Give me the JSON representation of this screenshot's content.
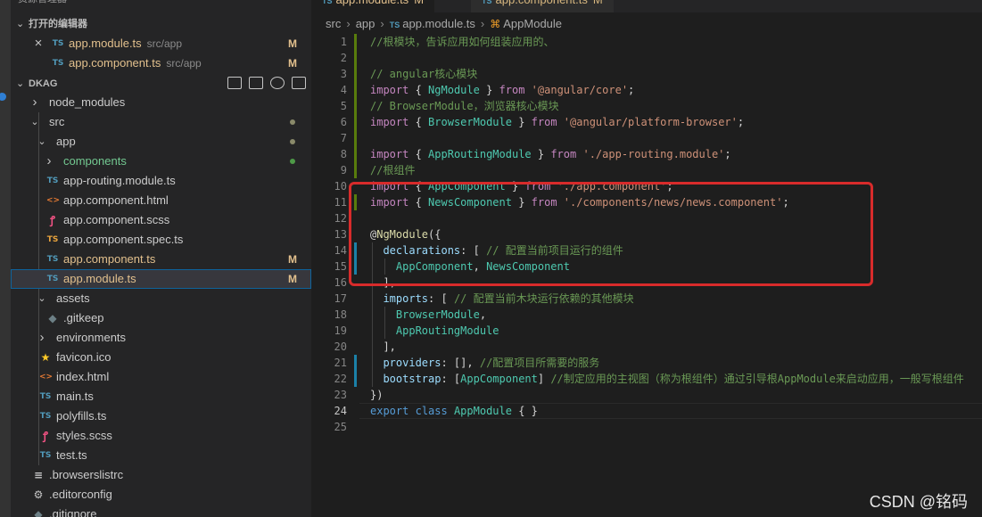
{
  "sidebar": {
    "open_editors_title": "打开的编辑器",
    "top_clipped_title": "资源管理器",
    "open_editors": [
      {
        "name": "app.module.ts",
        "path": "src/app",
        "status": "M"
      },
      {
        "name": "app.component.ts",
        "path": "src/app",
        "status": "M"
      }
    ],
    "close_icon": "×",
    "project_title": "DKAG",
    "tree": [
      {
        "name": "node_modules",
        "kind": "folder",
        "collapsed": true
      },
      {
        "name": "src",
        "kind": "folder",
        "collapsed": false
      },
      {
        "name": "app",
        "kind": "folder",
        "collapsed": false
      },
      {
        "name": "components",
        "kind": "folder",
        "collapsed": true
      },
      {
        "name": "app-routing.module.ts",
        "kind": "ts"
      },
      {
        "name": "app.component.html",
        "kind": "html"
      },
      {
        "name": "app.component.scss",
        "kind": "scss"
      },
      {
        "name": "app.component.spec.ts",
        "kind": "spec"
      },
      {
        "name": "app.component.ts",
        "kind": "ts",
        "status": "M"
      },
      {
        "name": "app.module.ts",
        "kind": "ts",
        "status": "M"
      },
      {
        "name": "assets",
        "kind": "folder",
        "collapsed": false
      },
      {
        "name": ".gitkeep",
        "kind": "git"
      },
      {
        "name": "environments",
        "kind": "folder",
        "collapsed": true
      },
      {
        "name": "favicon.ico",
        "kind": "star"
      },
      {
        "name": "index.html",
        "kind": "html"
      },
      {
        "name": "main.ts",
        "kind": "ts"
      },
      {
        "name": "polyfills.ts",
        "kind": "ts"
      },
      {
        "name": "styles.scss",
        "kind": "scss"
      },
      {
        "name": "test.ts",
        "kind": "ts"
      },
      {
        "name": ".browserslistrc",
        "kind": "lines"
      },
      {
        "name": ".editorconfig",
        "kind": "gear"
      },
      {
        "name": ".gitignore",
        "kind": "git"
      }
    ],
    "icon_glyphs": {
      "ts": "TS",
      "html": "<>",
      "scss": "ꝭ",
      "spec": "TS",
      "git": "◆",
      "star": "★",
      "lines": "≡",
      "gear": "⚙"
    }
  },
  "editor": {
    "tabs": [
      {
        "name": "app.module.ts",
        "status": "M"
      },
      {
        "name": "app.component.ts",
        "status": "M"
      }
    ],
    "breadcrumb": [
      "src",
      "app",
      "app.module.ts",
      "AppModule"
    ],
    "current_line": 24,
    "lines": [
      [
        [
          "c-com",
          "//根模块，告诉应用如何组装应用的、"
        ]
      ],
      [],
      [
        [
          "c-com",
          "// angular核心模块"
        ]
      ],
      [
        [
          "c-kw",
          "import"
        ],
        [
          "c-pun",
          " { "
        ],
        [
          "c-cls",
          "NgModule"
        ],
        [
          "c-pun",
          " } "
        ],
        [
          "c-kw",
          "from"
        ],
        [
          "c-pun",
          " "
        ],
        [
          "c-str",
          "'@angular/core'"
        ],
        [
          "c-pun",
          ";"
        ]
      ],
      [
        [
          "c-com",
          "// BrowserModule，浏览器核心模块"
        ]
      ],
      [
        [
          "c-kw",
          "import"
        ],
        [
          "c-pun",
          " { "
        ],
        [
          "c-cls",
          "BrowserModule"
        ],
        [
          "c-pun",
          " } "
        ],
        [
          "c-kw",
          "from"
        ],
        [
          "c-pun",
          " "
        ],
        [
          "c-str",
          "'@angular/platform-browser'"
        ],
        [
          "c-pun",
          ";"
        ]
      ],
      [],
      [
        [
          "c-kw",
          "import"
        ],
        [
          "c-pun",
          " { "
        ],
        [
          "c-cls",
          "AppRoutingModule"
        ],
        [
          "c-pun",
          " } "
        ],
        [
          "c-kw",
          "from"
        ],
        [
          "c-pun",
          " "
        ],
        [
          "c-str",
          "'./app-routing.module'"
        ],
        [
          "c-pun",
          ";"
        ]
      ],
      [
        [
          "c-com",
          "//根组件"
        ]
      ],
      [
        [
          "c-kw",
          "import"
        ],
        [
          "c-pun",
          " { "
        ],
        [
          "c-cls",
          "AppComponent"
        ],
        [
          "c-pun",
          " } "
        ],
        [
          "c-kw",
          "from"
        ],
        [
          "c-pun",
          " "
        ],
        [
          "c-str",
          "'./app.component'"
        ],
        [
          "c-pun",
          ";"
        ]
      ],
      [
        [
          "c-kw",
          "import"
        ],
        [
          "c-pun",
          " { "
        ],
        [
          "c-cls",
          "NewsComponent"
        ],
        [
          "c-pun",
          " } "
        ],
        [
          "c-kw",
          "from"
        ],
        [
          "c-pun",
          " "
        ],
        [
          "c-str",
          "'./components/news/news.component'"
        ],
        [
          "c-pun",
          ";"
        ]
      ],
      [],
      [
        [
          "c-pun",
          "@"
        ],
        [
          "c-dec",
          "NgModule"
        ],
        [
          "c-pun",
          "({"
        ]
      ],
      [
        [
          "c-pun",
          "  "
        ],
        [
          "c-prop",
          "declarations"
        ],
        [
          "c-pun",
          ": [ "
        ],
        [
          "c-com",
          "// 配置当前项目运行的组件"
        ]
      ],
      [
        [
          "c-pun",
          "    "
        ],
        [
          "c-cls",
          "AppComponent"
        ],
        [
          "c-pun",
          ", "
        ],
        [
          "c-cls",
          "NewsComponent"
        ]
      ],
      [
        [
          "c-pun",
          "  ],"
        ]
      ],
      [
        [
          "c-pun",
          "  "
        ],
        [
          "c-prop",
          "imports"
        ],
        [
          "c-pun",
          ": [ "
        ],
        [
          "c-com",
          "// 配置当前木块运行依赖的其他模块"
        ]
      ],
      [
        [
          "c-pun",
          "    "
        ],
        [
          "c-cls",
          "BrowserModule"
        ],
        [
          "c-pun",
          ","
        ]
      ],
      [
        [
          "c-pun",
          "    "
        ],
        [
          "c-cls",
          "AppRoutingModule"
        ]
      ],
      [
        [
          "c-pun",
          "  ],"
        ]
      ],
      [
        [
          "c-pun",
          "  "
        ],
        [
          "c-prop",
          "providers"
        ],
        [
          "c-pun",
          ": [], "
        ],
        [
          "c-com",
          "//配置项目所需要的服务"
        ]
      ],
      [
        [
          "c-pun",
          "  "
        ],
        [
          "c-prop",
          "bootstrap"
        ],
        [
          "c-pun",
          ": ["
        ],
        [
          "c-cls",
          "AppComponent"
        ],
        [
          "c-pun",
          "] "
        ],
        [
          "c-com",
          "//制定应用的主视图（称为根组件）通过引导根AppModule来启动应用，一般写根组件"
        ]
      ],
      [
        [
          "c-pun",
          "})"
        ]
      ],
      [
        [
          "c-kw2",
          "export"
        ],
        [
          "c-pun",
          " "
        ],
        [
          "c-kw2",
          "class"
        ],
        [
          "c-pun",
          " "
        ],
        [
          "c-cls",
          "AppModule"
        ],
        [
          "c-pun",
          " { }"
        ]
      ],
      []
    ]
  },
  "watermark": "CSDN @铭码",
  "colors": {
    "accent": "#0e639c",
    "modified": "#e2c08d",
    "highlight_box": "#d82b2b",
    "added_gutter": "#587c0c",
    "modified_gutter": "#1b81a8"
  }
}
